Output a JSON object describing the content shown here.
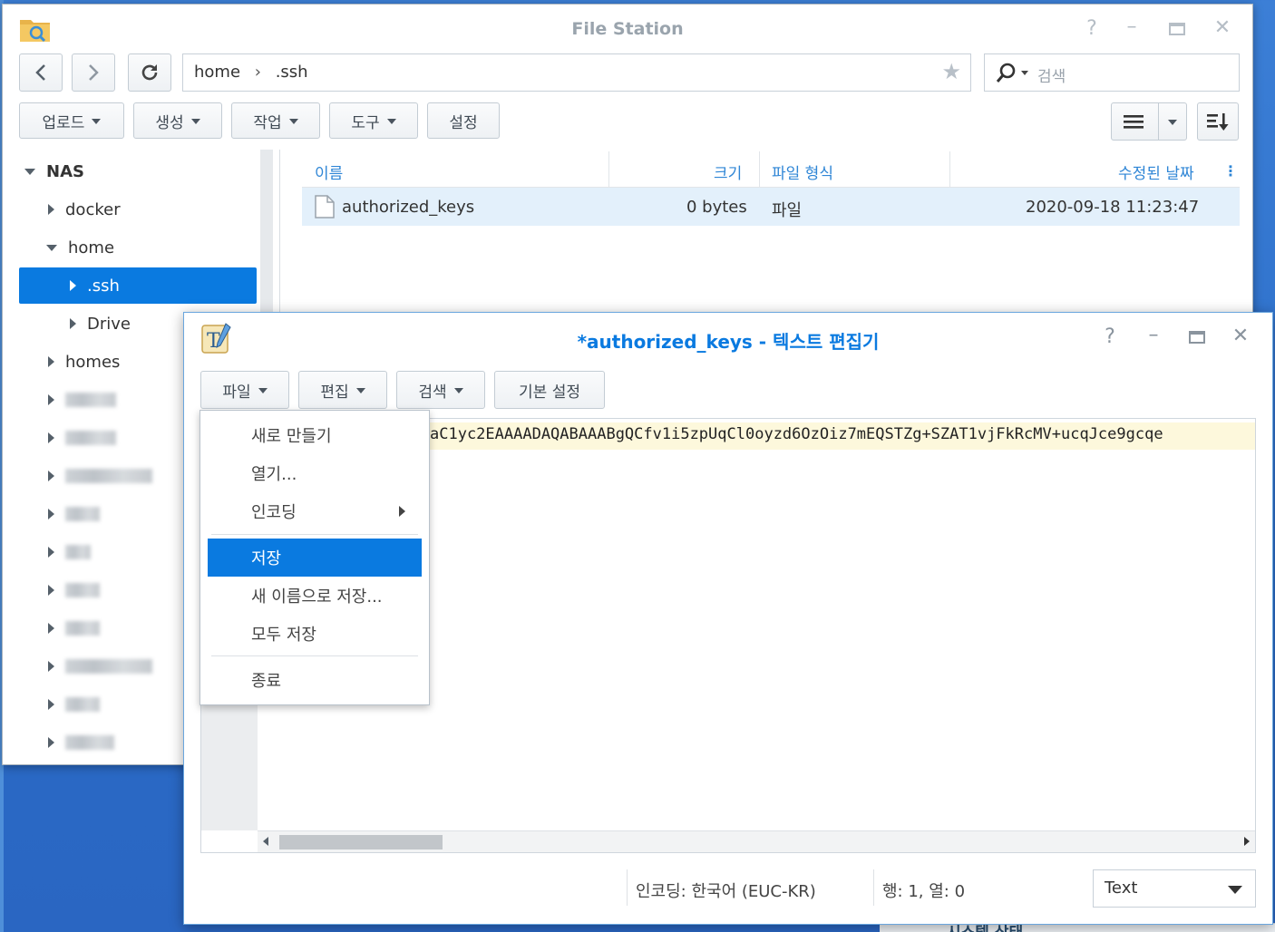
{
  "file_station": {
    "title": "File Station",
    "path": {
      "segments": [
        "home",
        ".ssh"
      ],
      "separator": "›"
    },
    "search": {
      "placeholder": "검색"
    },
    "toolbar": {
      "upload": "업로드",
      "create": "생성",
      "action": "작업",
      "tools": "도구",
      "settings": "설정"
    },
    "tree": {
      "root": "NAS",
      "items": {
        "docker": "docker",
        "home": "home",
        "ssh": ".ssh",
        "drive": "Drive",
        "homes": "homes"
      }
    },
    "columns": {
      "name": "이름",
      "size": "크기",
      "type": "파일 형식",
      "modified": "수정된 날짜"
    },
    "files": [
      {
        "name": "authorized_keys",
        "size": "0 bytes",
        "type": "파일",
        "modified": "2020-09-18 11:23:47"
      }
    ]
  },
  "text_editor": {
    "title": "*authorized_keys - 텍스트 편집기",
    "menus": {
      "file": "파일",
      "edit": "편집",
      "search": "검색",
      "preferences": "기본 설정"
    },
    "content_visible": "aC1yc2EAAAADAQABAAABgQCfv1i5zpUqCl0oyzd6OzOiz7mEQSTZg+SZAT1vjFkRcMV+ucqJce9gcqe",
    "status": {
      "encoding": "인코딩: 한국어 (EUC-KR)",
      "position": "행: 1, 열: 0",
      "syntax": "Text"
    },
    "file_menu": {
      "new": "새로 만들기",
      "open": "열기...",
      "encoding": "인코딩",
      "save": "저장",
      "save_as": "새 이름으로 저장...",
      "save_all": "모두 저장",
      "exit": "종료"
    }
  },
  "desktop": {
    "widget_peek_text": "시스템 상태"
  },
  "colors": {
    "accent": "#0a7ae0",
    "desktop": "#2a6cc8",
    "row_selected": "#e3f0fb"
  }
}
